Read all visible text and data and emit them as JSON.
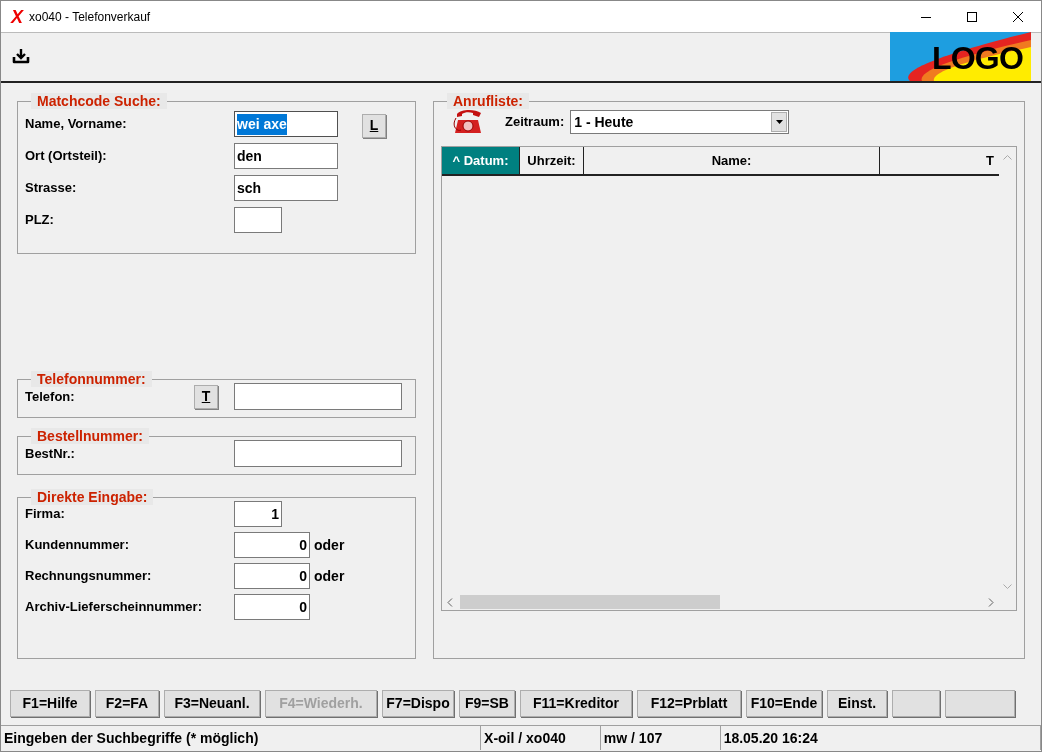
{
  "window": {
    "app_icon": "X",
    "title": "xo040 - Telefonverkauf"
  },
  "toolbar": {
    "logo": "LOGO"
  },
  "matchcode": {
    "title": "Matchcode Suche:",
    "fields": [
      {
        "label": "Name, Vorname:",
        "value": "wei axe",
        "selected": true
      },
      {
        "label": "Ort (Ortsteil):",
        "value": "den",
        "selected": false
      },
      {
        "label": "Strasse:",
        "value": "sch",
        "selected": false
      },
      {
        "label": "PLZ:",
        "selected": false
      }
    ],
    "button": {
      "label": "L",
      "underlined": true
    }
  },
  "telefon": {
    "title": "Telefonnummer:",
    "label": "Telefon:",
    "button": {
      "label": "T",
      "underlined": true
    }
  },
  "bestellnummer": {
    "title": "Bestellnummer:",
    "label": "BestNr.:"
  },
  "direkt": {
    "title": "Direkte Eingabe:",
    "fields": [
      {
        "label": "Firma:",
        "value": "1"
      },
      {
        "label": "Kundennummer:",
        "value": "0",
        "suffix": "oder"
      },
      {
        "label": "Rechnungsnummer:",
        "value": "0",
        "suffix": "oder"
      },
      {
        "label": "Archiv-Lieferscheinnummer:",
        "value": "0"
      }
    ]
  },
  "anrufliste": {
    "title": "Anrufliste:",
    "zeitraum_label": "Zeitraum:",
    "zeitraum_value": "1 - Heute",
    "columns": [
      {
        "label": "^ Datum:",
        "selected": true
      },
      {
        "label": "Uhrzeit:",
        "selected": false
      },
      {
        "label": "Name:",
        "selected": false
      },
      {
        "label": "T",
        "selected": false
      }
    ]
  },
  "buttons": [
    {
      "label": "F1=Hilfe",
      "disabled": false
    },
    {
      "label": "F2=FA",
      "disabled": false
    },
    {
      "label": "F3=Neuanl.",
      "disabled": false
    },
    {
      "label": "F4=Wiederh.",
      "disabled": true
    },
    {
      "label": "F7=Dispo",
      "disabled": false
    },
    {
      "label": "F9=SB",
      "disabled": false
    },
    {
      "label": "F11=Kreditor",
      "disabled": false
    },
    {
      "label": "F12=Prblatt",
      "disabled": false
    },
    {
      "label": "F10=Ende",
      "disabled": false
    },
    {
      "label": "Einst.",
      "disabled": false
    }
  ],
  "status_bar": [
    "Eingeben der Suchbegriffe (* möglich)",
    "X-oil / xo040",
    "mw / 107",
    "18.05.20 16:24"
  ]
}
